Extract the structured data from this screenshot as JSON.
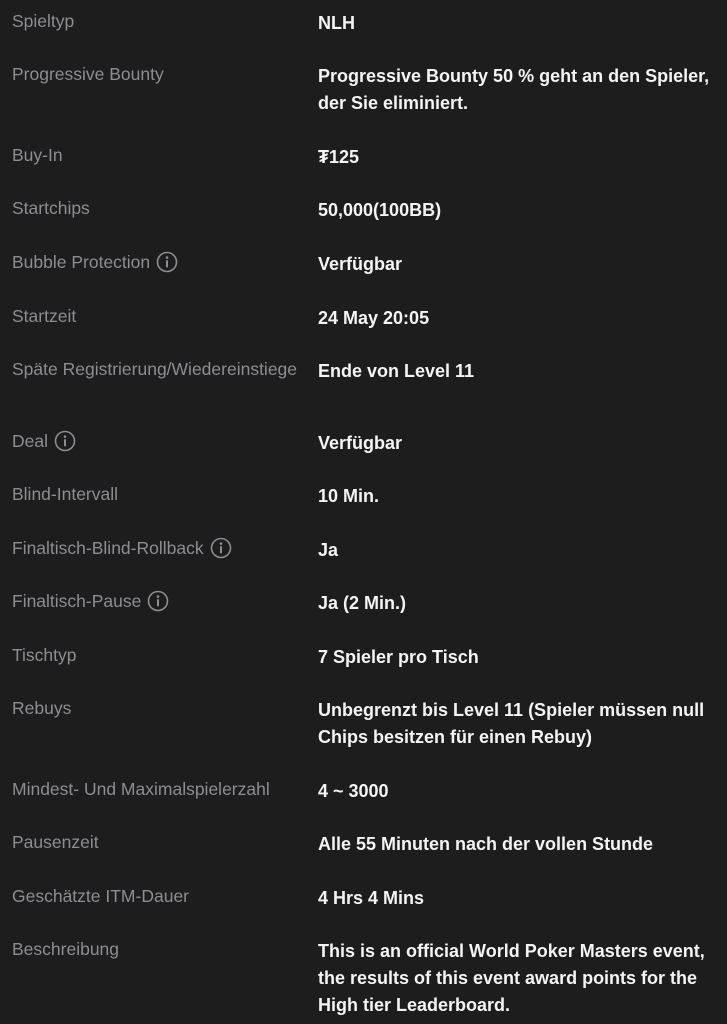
{
  "details": [
    {
      "label": "Spieltyp",
      "value": "NLH"
    },
    {
      "label": "Progressive Bounty",
      "value": "Progressive Bounty 50 % geht an den Spieler, der Sie eliminiert."
    },
    {
      "label": "Buy-In",
      "value": "₮125"
    },
    {
      "label": "Startchips",
      "value": "50,000(100BB)"
    },
    {
      "label": "Bubble Protection",
      "value": "Verfügbar",
      "info_icon": "info-icon"
    },
    {
      "label": "Startzeit",
      "value": "24 May 20:05"
    },
    {
      "label": "Späte Registrierung/Wiedereinstiege",
      "value": "Ende von Level 11"
    },
    {
      "label": "Deal",
      "value": "Verfügbar",
      "info_icon": "info-icon"
    },
    {
      "label": "Blind-Intervall",
      "value": "10 Min."
    },
    {
      "label": "Finaltisch-Blind-Rollback",
      "value": "Ja",
      "info_icon": "info-icon"
    },
    {
      "label": "Finaltisch-Pause",
      "value": "Ja (2 Min.)",
      "info_icon": "info-icon"
    },
    {
      "label": "Tischtyp",
      "value": "7 Spieler pro Tisch"
    },
    {
      "label": "Rebuys",
      "value": "Unbegrenzt bis Level 11 (Spieler müssen null Chips besitzen für einen Rebuy)"
    },
    {
      "label": "Mindest- Und Maximalspielerzahl",
      "value": "4 ~ 3000"
    },
    {
      "label": "Pausenzeit",
      "value": "Alle 55 Minuten nach der vollen Stunde"
    },
    {
      "label": "Geschätzte ITM-Dauer",
      "value": "4 Hrs 4 Mins"
    },
    {
      "label": "Beschreibung",
      "value": "This is an official World Poker Masters event, the results of this event award points for the High tier Leaderboard."
    }
  ],
  "colors": {
    "background": "#1d1d1e",
    "label": "#8d8d92",
    "value": "#f4f4f4"
  }
}
